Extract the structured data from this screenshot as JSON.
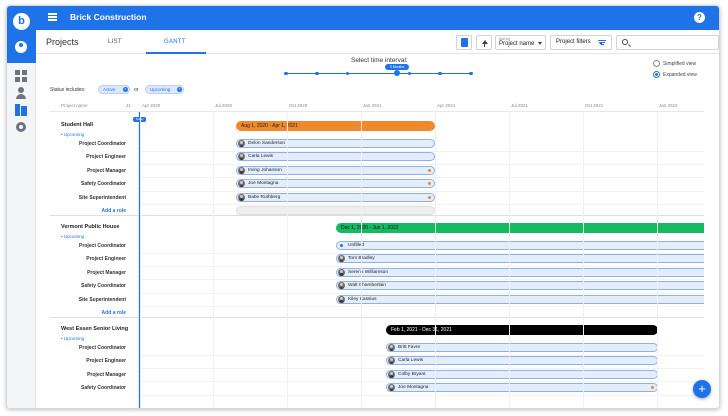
{
  "app": {
    "title": "Brick Construction",
    "logo_letter": "b"
  },
  "toolbar": {
    "title": "Projects",
    "tabs": [
      {
        "label": "LIST"
      },
      {
        "label": "GANTT"
      }
    ],
    "sort": {
      "label": "Sort by",
      "value": "Project name"
    },
    "filters_label": "Project filters",
    "search_placeholder": ""
  },
  "interval": {
    "title": "Select time interval:",
    "selected": "3 Months",
    "stops": 7,
    "selected_index": 3
  },
  "view_options": [
    {
      "label": "Simplified view",
      "checked": false
    },
    {
      "label": "Expanded view",
      "checked": true
    }
  ],
  "status": {
    "label": "Status includes:",
    "chips": [
      "Active",
      "Upcoming"
    ],
    "joiner": "or"
  },
  "gantt": {
    "name_col_label": "Project name",
    "today_label": "Today",
    "date_columns": [
      "21",
      "Apr 2020",
      "Jul 2020",
      "Oct 2020",
      "Jan 2021",
      "Apr 2021",
      "Jul 2021",
      "Oct 2021",
      "Jan 2022"
    ],
    "add_role_label": "Add a role",
    "projects": [
      {
        "name": "Student Hall",
        "status": "Upcoming",
        "range_label": "Aug 1, 2020 - Apr 1, 2021",
        "roles": [
          {
            "role": "Project Coordinator",
            "person": "Delon Sanderson",
            "warn": false
          },
          {
            "role": "Project Engineer",
            "person": "Carla Lewis",
            "warn": false
          },
          {
            "role": "Project Manager",
            "person": "Irving Johanson",
            "warn": true
          },
          {
            "role": "Safety Coordinator",
            "person": "Joe Montagna",
            "warn": true
          },
          {
            "role": "Site Superintendent",
            "person": "Babe Ruthberg",
            "warn": true
          }
        ]
      },
      {
        "name": "Vermont Public House",
        "status": "Upcoming",
        "range_label": "Dec 1, 2020 - Jun 1, 2022",
        "roles": [
          {
            "role": "Project Coordinator",
            "person": "Unfilled",
            "warn": false
          },
          {
            "role": "Project Engineer",
            "person": "Tom Bradley",
            "warn": false
          },
          {
            "role": "Project Manager",
            "person": "Serena Williamson",
            "warn": false
          },
          {
            "role": "Safety Coordinator",
            "person": "Walt Chamberlain",
            "warn": false
          },
          {
            "role": "Site Superintendent",
            "person": "Kiley Kassius",
            "warn": false
          }
        ]
      },
      {
        "name": "West Essen Senior Living",
        "status": "Upcoming",
        "range_label": "Feb 1, 2021 - Dec 31, 2021",
        "roles": [
          {
            "role": "Project Coordinator",
            "person": "Britt Favre",
            "warn": false
          },
          {
            "role": "Project Engineer",
            "person": "Carla Lewis",
            "warn": false
          },
          {
            "role": "Project Manager",
            "person": "Colby Bryant",
            "warn": false
          },
          {
            "role": "Safety Coordinator",
            "person": "Joe Montagna",
            "warn": true
          }
        ]
      }
    ]
  },
  "colors": {
    "brand": "#1f73e8",
    "orange": "#f0882c",
    "green": "#16b862",
    "black": "#000000"
  },
  "icons": [
    "menu-icon",
    "help-icon",
    "user-icon",
    "dashboard-icon",
    "person-icon",
    "projects-icon",
    "gear-icon",
    "document-icon",
    "sort-direction-icon",
    "filter-icon",
    "search-icon",
    "add-icon"
  ]
}
